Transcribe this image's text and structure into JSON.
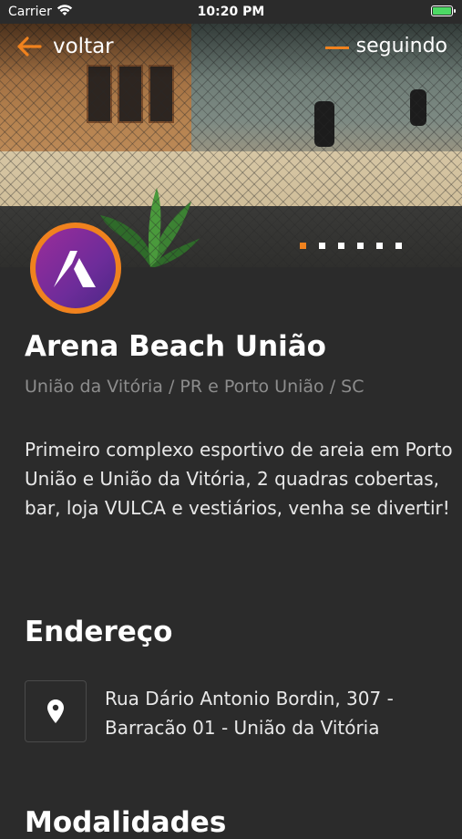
{
  "status_bar": {
    "carrier": "Carrier",
    "time": "10:20 PM"
  },
  "header": {
    "back_label": "voltar",
    "follow_label": "seguindo",
    "accent_color": "#f0821e"
  },
  "carousel": {
    "total_slides": 6,
    "active_index": 0
  },
  "venue": {
    "name": "Arena Beach União",
    "location": "União da Vitória / PR e Porto União / SC",
    "description": "Primeiro complexo esportivo de areia em Porto União e União da Vitória, 2 quadras cobertas, bar, loja VULCA e vestiários, venha se divertir!"
  },
  "address_section": {
    "title": "Endereço",
    "icon": "location-pin-icon",
    "address": "Rua Dário Antonio Bordin, 307 - Barracão 01 - União da Vitória"
  },
  "next_section": {
    "title": "Modalidades"
  }
}
